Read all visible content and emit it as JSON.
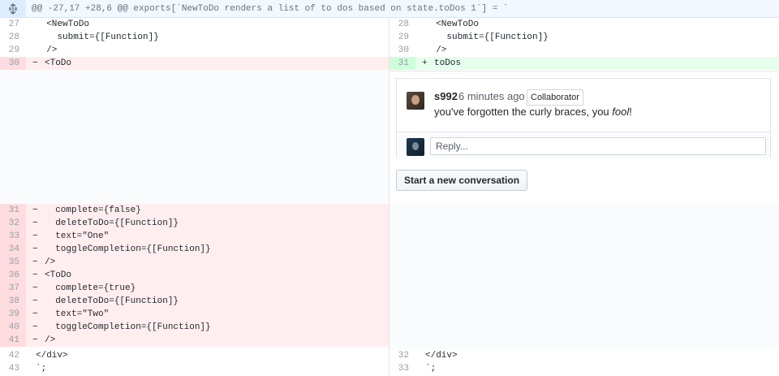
{
  "hunk": {
    "header": "@@ -27,17 +28,6 @@ exports[`NewToDo renders a list of to dos based on state.toDos 1`] = `"
  },
  "left_lines": [
    {
      "num": "27",
      "type": "ctx",
      "marker": "",
      "code": "  <NewToDo"
    },
    {
      "num": "28",
      "type": "ctx",
      "marker": "",
      "code": "    submit={[Function]}"
    },
    {
      "num": "29",
      "type": "ctx",
      "marker": "",
      "code": "  />"
    },
    {
      "num": "30",
      "type": "del",
      "marker": "−",
      "code": "<ToDo"
    },
    {
      "num": "31",
      "type": "del",
      "marker": "−",
      "code": "  complete={false}"
    },
    {
      "num": "32",
      "type": "del",
      "marker": "−",
      "code": "  deleteToDo={[Function]}"
    },
    {
      "num": "33",
      "type": "del",
      "marker": "−",
      "code": "  text=\"One\""
    },
    {
      "num": "34",
      "type": "del",
      "marker": "−",
      "code": "  toggleCompletion={[Function]}"
    },
    {
      "num": "35",
      "type": "del",
      "marker": "−",
      "code": "/>"
    },
    {
      "num": "36",
      "type": "del",
      "marker": "−",
      "code": "<ToDo"
    },
    {
      "num": "37",
      "type": "del",
      "marker": "−",
      "code": "  complete={true}"
    },
    {
      "num": "38",
      "type": "del",
      "marker": "−",
      "code": "  deleteToDo={[Function]}"
    },
    {
      "num": "39",
      "type": "del",
      "marker": "−",
      "code": "  text=\"Two\""
    },
    {
      "num": "40",
      "type": "del",
      "marker": "−",
      "code": "  toggleCompletion={[Function]}"
    },
    {
      "num": "41",
      "type": "del",
      "marker": "−",
      "code": "/>"
    },
    {
      "num": "42",
      "type": "ctx",
      "marker": "",
      "code": "</div>"
    },
    {
      "num": "43",
      "type": "ctx",
      "marker": "",
      "code": "`;"
    }
  ],
  "right_lines": [
    {
      "num": "28",
      "type": "ctx",
      "marker": "",
      "code": "  <NewToDo"
    },
    {
      "num": "29",
      "type": "ctx",
      "marker": "",
      "code": "    submit={[Function]}"
    },
    {
      "num": "30",
      "type": "ctx",
      "marker": "",
      "code": "  />"
    },
    {
      "num": "31",
      "type": "add",
      "marker": "+",
      "code": "toDos"
    },
    {
      "num": "32",
      "type": "ctx",
      "marker": "",
      "code": "</div>"
    },
    {
      "num": "33",
      "type": "ctx",
      "marker": "",
      "code": "`;"
    }
  ],
  "comment": {
    "author": "s992",
    "time": "6 minutes ago",
    "badge": "Collaborator",
    "body_before": "you've forgotten the curly braces, you ",
    "body_em": "fool",
    "body_after": "!"
  },
  "reply": {
    "placeholder": "Reply..."
  },
  "new_conversation": {
    "label": "Start a new conversation"
  },
  "colors": {
    "deletion_bg": "#ffeef0",
    "addition_bg": "#e6ffed",
    "hunk_bg": "#f1f8ff"
  }
}
